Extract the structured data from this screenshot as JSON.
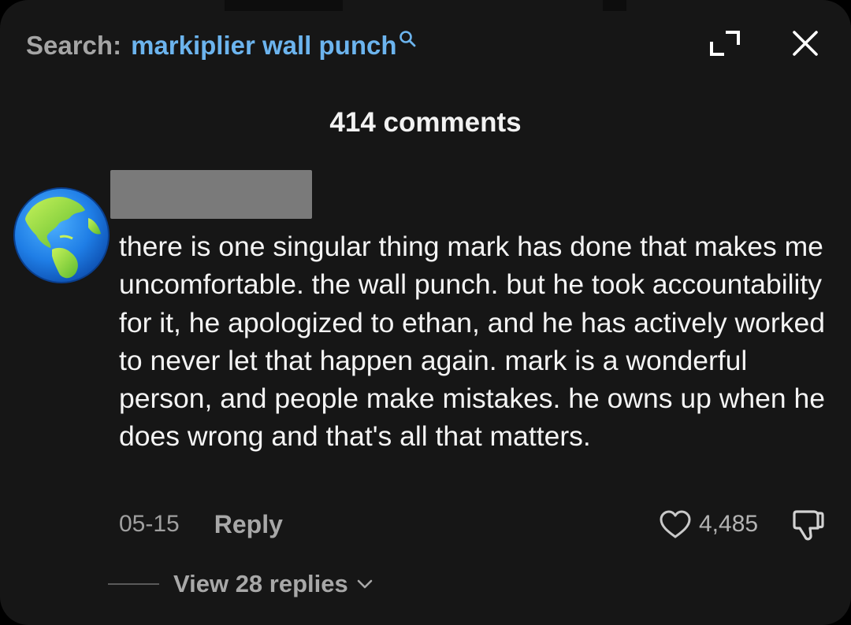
{
  "header": {
    "search_label": "Search:",
    "search_query": "markiplier wall punch",
    "search_icon": "search-icon",
    "expand_icon": "expand-icon",
    "close_icon": "close-icon"
  },
  "comments": {
    "count_label": "414 comments"
  },
  "comment": {
    "avatar_icon": "globe-americas-icon",
    "text": "there is one singular thing mark has done that makes me uncomfortable. the wall punch. but he took accountability for it, he apologized to ethan, and he has actively worked to never let that happen again. mark is a wonderful person, and people make mistakes. he owns up when he does wrong and that's all that matters.",
    "date": "05-15",
    "reply_label": "Reply",
    "like_count": "4,485",
    "like_icon": "heart-icon",
    "dislike_icon": "thumbs-down-icon",
    "view_replies_label": "View 28 replies",
    "view_replies_icon": "chevron-down-icon"
  },
  "colors": {
    "background": "#161616",
    "accent_link": "#6cb4ee",
    "text_primary": "#f4f4f4",
    "text_secondary": "#a8a8a8"
  }
}
